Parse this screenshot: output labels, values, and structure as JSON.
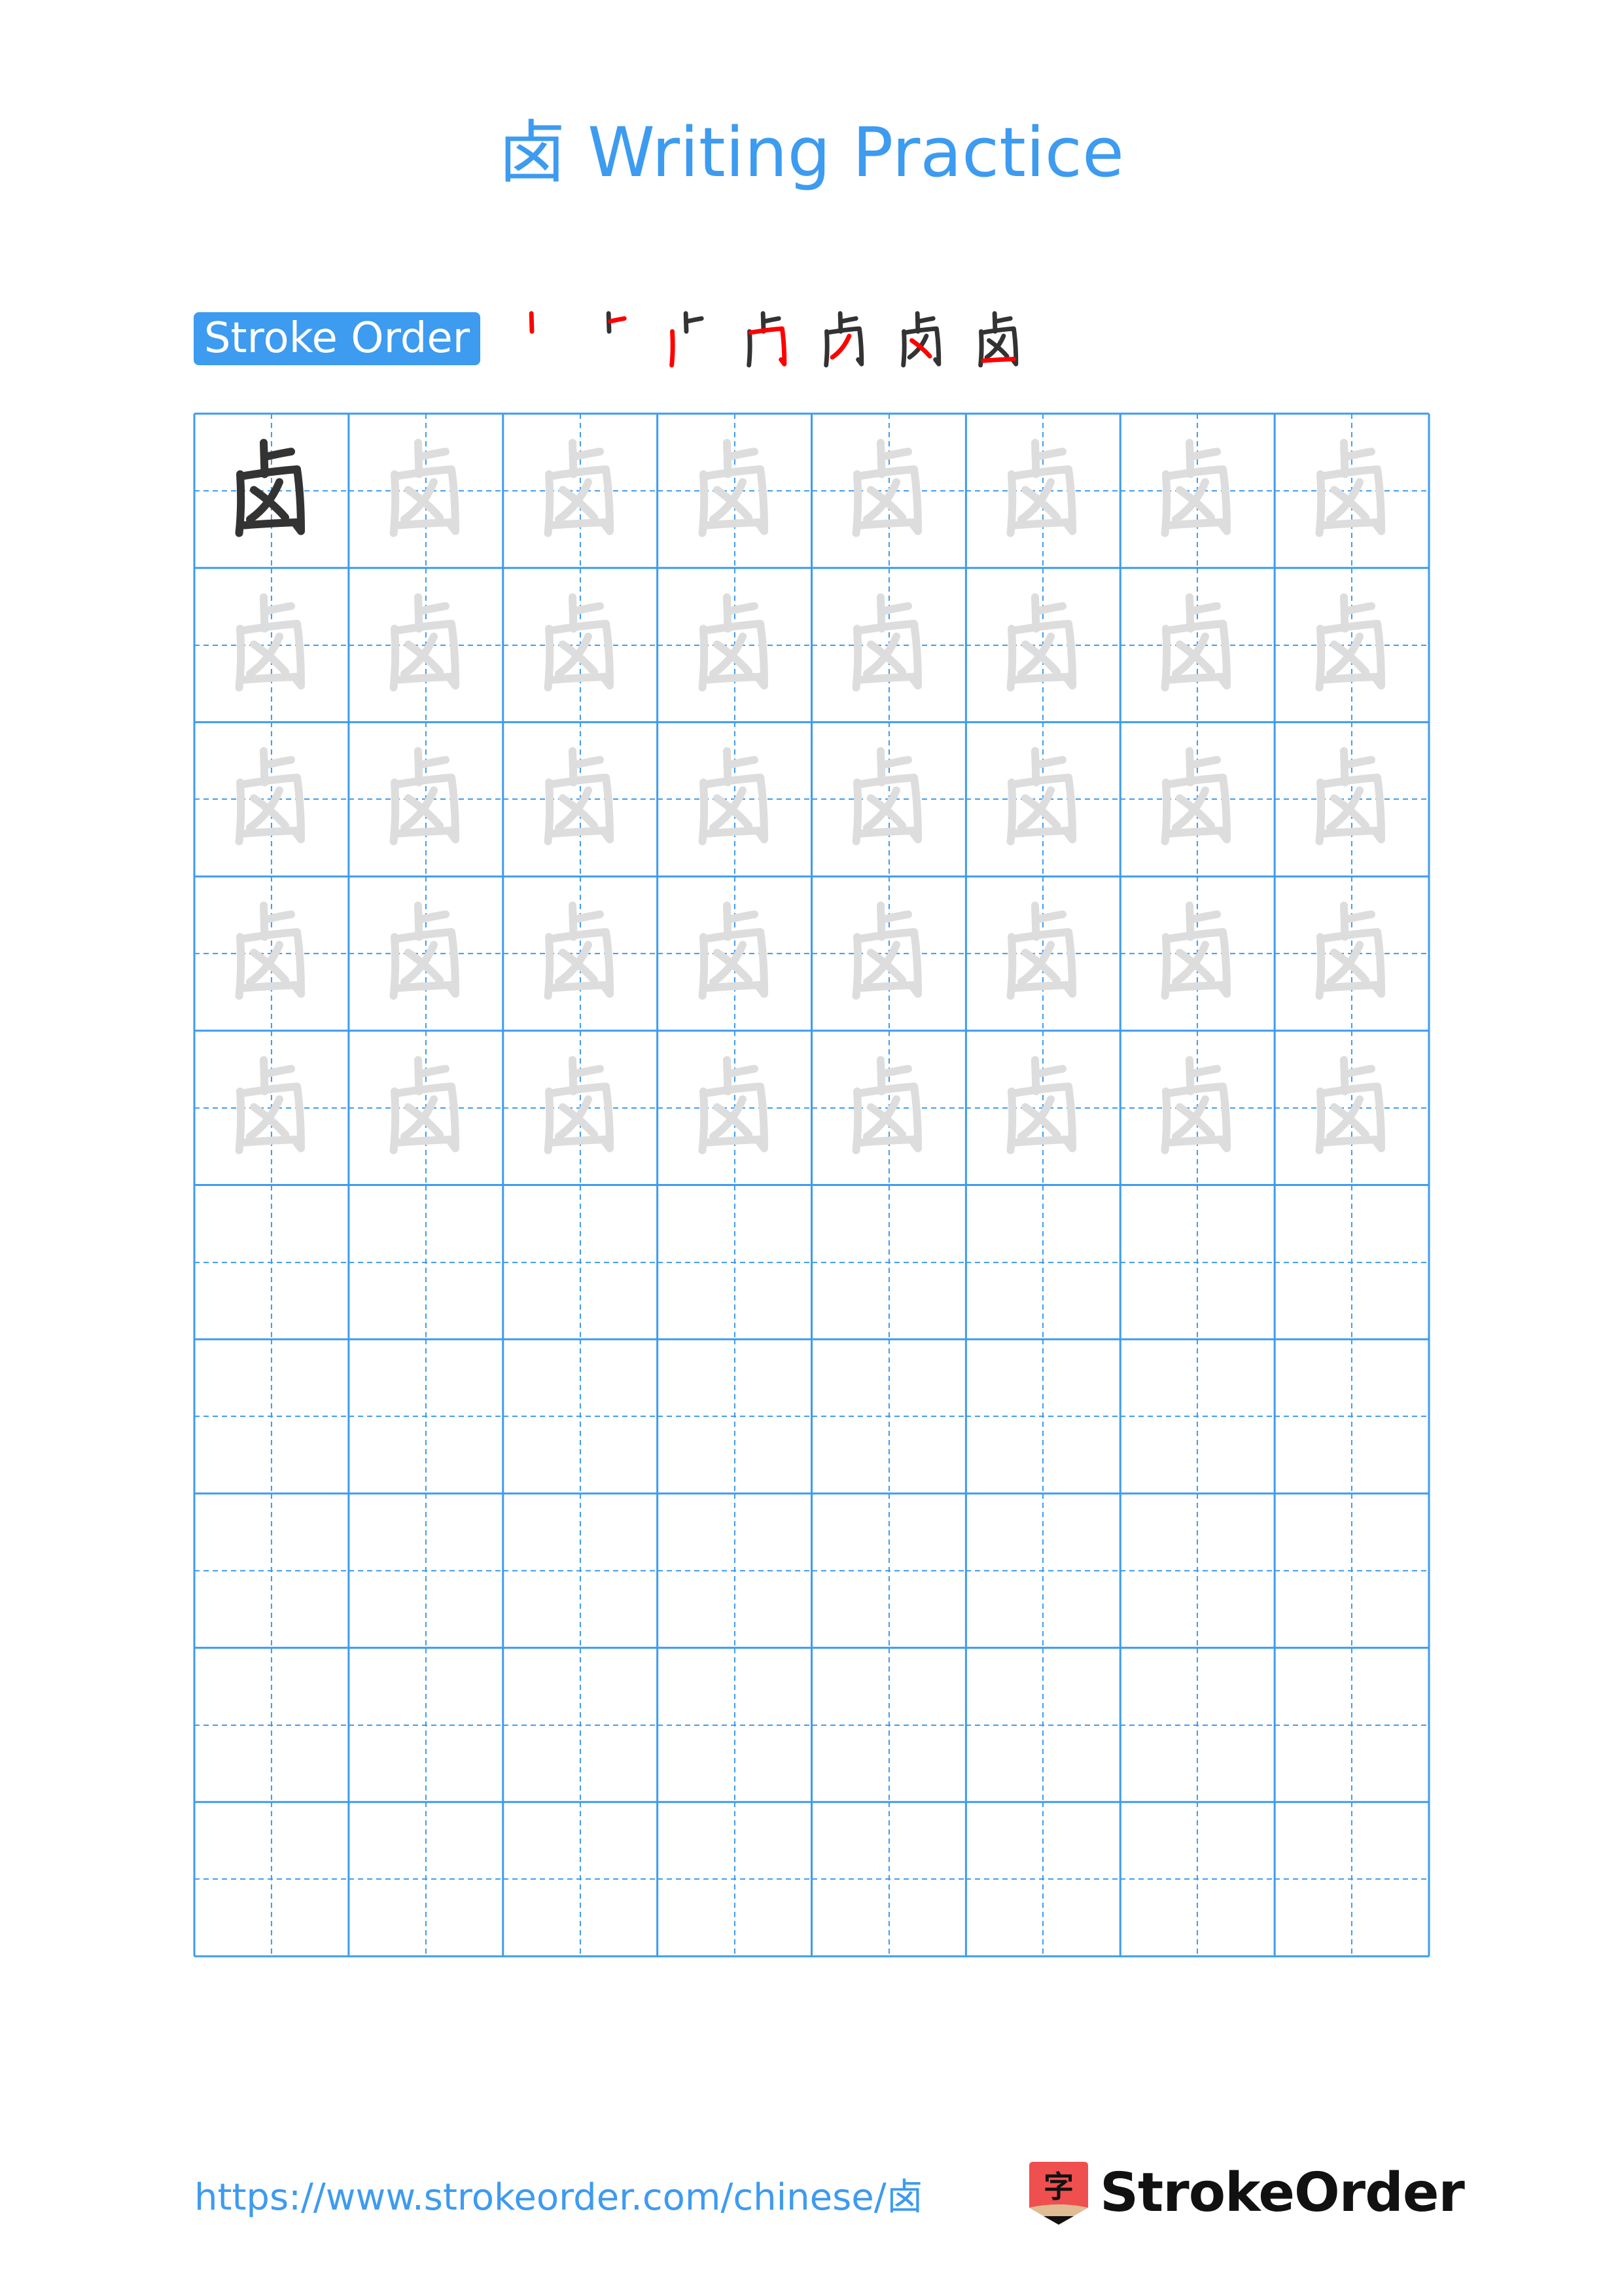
{
  "page": {
    "title": "卤 Writing Practice",
    "character": "卤"
  },
  "stroke_order": {
    "label": "Stroke Order",
    "step_count": 7,
    "steps": [
      {
        "step": 1,
        "description": "vertical stroke (丨) of top 卜"
      },
      {
        "step": 2,
        "description": "short horizontal tick of top 卜"
      },
      {
        "step": 3,
        "description": "left vertical of enclosure"
      },
      {
        "step": 4,
        "description": "top-right horizontal-turn with hook (𠃍)"
      },
      {
        "step": 5,
        "description": "left-falling stroke (丿) inside"
      },
      {
        "step": 6,
        "description": "dot stroke (丶) inside"
      },
      {
        "step": 7,
        "description": "bottom horizontal closing stroke"
      }
    ]
  },
  "grid": {
    "columns": 8,
    "rows": 10,
    "model_cells": 1,
    "trace_rows": 5,
    "blank_rows": 5
  },
  "colors": {
    "accent": "#3d9bf0",
    "model_glyph": "#333333",
    "trace_glyph": "#dddddd",
    "current_stroke": "#ff0000",
    "logo_red": "#ef4f4f",
    "logo_tan": "#e0bb94",
    "logo_text": "#111111"
  },
  "footer": {
    "url": "https://www.strokeorder.com/chinese/卤",
    "logo_glyph": "字",
    "logo_text": "StrokeOrder"
  }
}
